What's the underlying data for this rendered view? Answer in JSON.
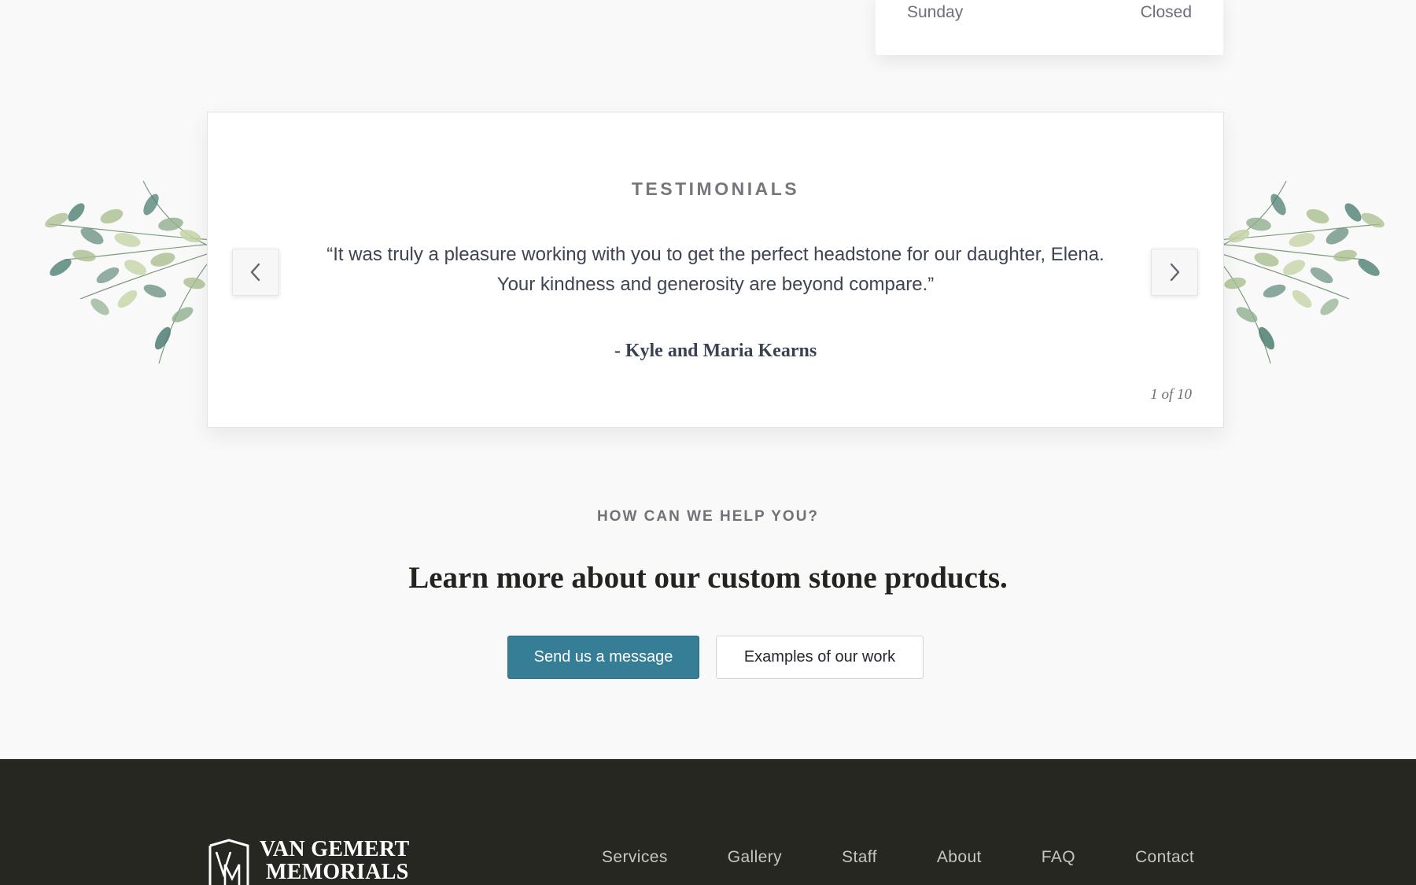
{
  "hours": {
    "day": "Sunday",
    "status": "Closed"
  },
  "testimonials": {
    "heading": "TESTIMONIALS",
    "quote": "“It was truly a pleasure working with you to get the perfect headstone for our daughter, Elena. Your kindness and generosity are beyond compare.”",
    "author": "- Kyle and Maria Kearns",
    "counter": "1 of 10",
    "prev_icon": "chevron-left-icon",
    "next_icon": "chevron-right-icon"
  },
  "help": {
    "eyebrow": "HOW CAN WE HELP YOU?",
    "title": "Learn more about our custom stone products.",
    "primary_button": "Send us a message",
    "secondary_button": "Examples of our work"
  },
  "footer": {
    "logo_line1": "VAN GEMERT",
    "logo_line2": "MEMORIALS",
    "nav": [
      "Services",
      "Gallery",
      "Staff",
      "About",
      "FAQ",
      "Contact"
    ]
  },
  "colors": {
    "page_bg": "#f9f9f9",
    "accent": "#367d96",
    "footer_bg": "#272722",
    "foliage_dark": "#4e7f72",
    "foliage_light": "#a9be8e"
  }
}
